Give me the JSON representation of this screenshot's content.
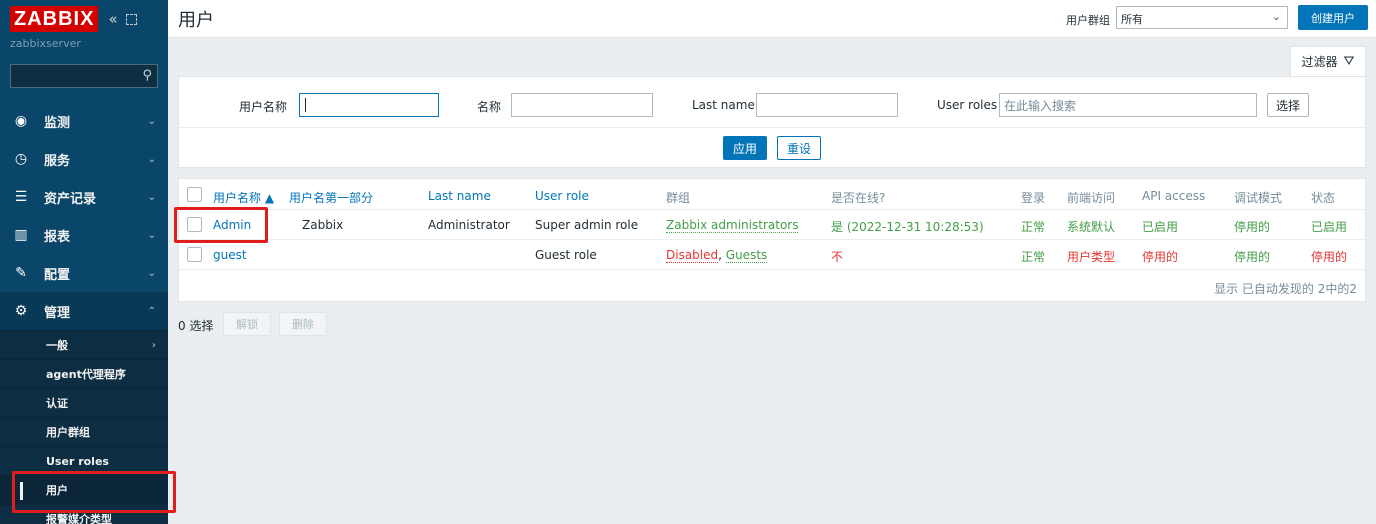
{
  "sidebar": {
    "logo": "ZABBIX",
    "collapse_icon": "«",
    "server": "zabbixserver",
    "menu": [
      {
        "icon": "eye-icon",
        "glyph": "◉",
        "label": "监测"
      },
      {
        "icon": "clock-icon",
        "glyph": "◷",
        "label": "服务"
      },
      {
        "icon": "list-icon",
        "glyph": "☰",
        "label": "资产记录"
      },
      {
        "icon": "chart-icon",
        "glyph": "▥",
        "label": "报表"
      },
      {
        "icon": "wrench-icon",
        "glyph": "✎",
        "label": "配置"
      },
      {
        "icon": "gear-icon",
        "glyph": "⚙",
        "label": "管理"
      }
    ],
    "submenu": [
      "一般",
      "agent代理程序",
      "认证",
      "用户群组",
      "User roles",
      "用户",
      "报警媒介类型"
    ]
  },
  "header": {
    "title": "用户",
    "group_label": "用户群组",
    "group_value": "所有",
    "create_button": "创建用户"
  },
  "filter": {
    "tab_label": "过滤器",
    "username_label": "用户名称",
    "name_label": "名称",
    "lastname_label": "Last name",
    "roles_label": "User roles",
    "roles_placeholder": "在此输入搜索",
    "select_button": "选择",
    "apply_button": "应用",
    "reset_button": "重设"
  },
  "table": {
    "columns": [
      "用户名称 ▲",
      "用户名第一部分",
      "Last name",
      "User role",
      "群组",
      "是否在线?",
      "登录",
      "前端访问",
      "API access",
      "调试模式",
      "状态"
    ],
    "rows": [
      {
        "username": "Admin",
        "first": "Zabbix",
        "last": "Administrator",
        "role": "Super admin role",
        "groups": "Zabbix administrators",
        "online": "是 (2022-12-31 10:28:53)",
        "login": "正常",
        "frontend": "系统默认",
        "api": "已启用",
        "debug": "停用的",
        "status": "已启用"
      },
      {
        "username": "guest",
        "first": "",
        "last": "",
        "role": "Guest role",
        "group1": "Disabled",
        "group_sep": ", ",
        "group2": "Guests",
        "online": "不",
        "login": "正常",
        "frontend": "用户类型",
        "api": "停用的",
        "debug": "停用的",
        "status": "停用的"
      }
    ],
    "footer": "显示 已自动发现的 2中的2"
  },
  "actions": {
    "selected": "0 选择",
    "unblock": "解锁",
    "delete": "删除"
  },
  "colors": {
    "brand": "#d40000",
    "sidebar": "#0a466a",
    "accent": "#0275b8",
    "ok": "#429e47",
    "bad": "#e33734"
  }
}
